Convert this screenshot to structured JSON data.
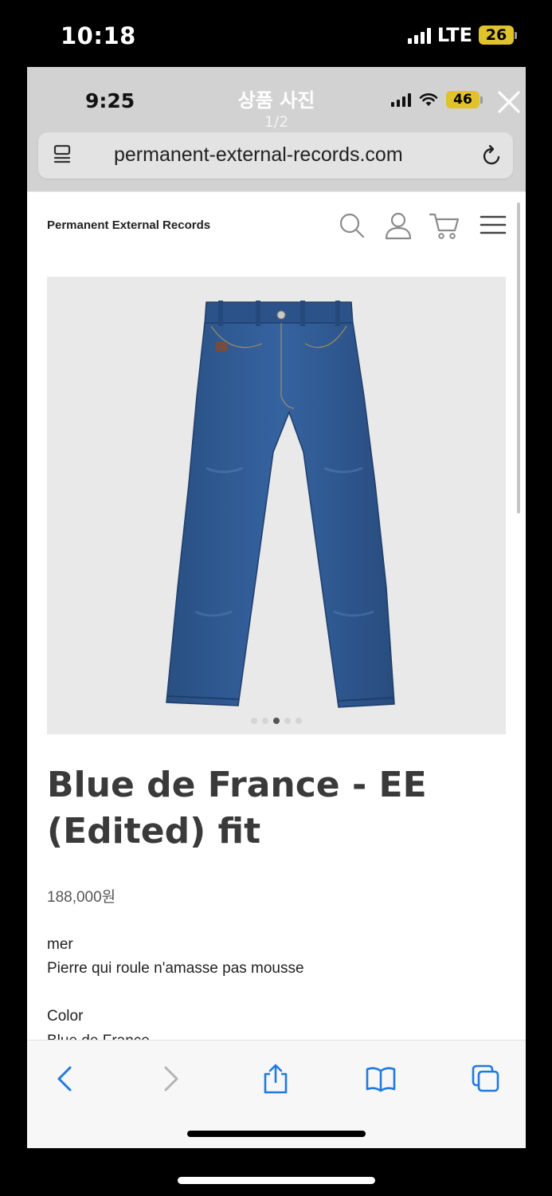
{
  "outer_status": {
    "time": "10:18",
    "network": "LTE",
    "battery": "26"
  },
  "inner_status": {
    "time": "9:25",
    "battery": "46"
  },
  "viewer": {
    "title": "상품 사진",
    "counter": "1/2"
  },
  "browser": {
    "url": "permanent-external-records.com"
  },
  "site": {
    "brand": "Permanent External Records"
  },
  "product": {
    "title": "Blue de France - EE (Edited) fit",
    "price": "188,000원",
    "desc_line1": "mer",
    "desc_line2": "Pierre qui roule n'amasse pas mousse",
    "color_label": "Color",
    "color_value": "Blue de France",
    "image_dots": 5,
    "active_dot": 3
  },
  "colors": {
    "accent": "#1f7ae0",
    "denim": "#2f5a8f"
  }
}
